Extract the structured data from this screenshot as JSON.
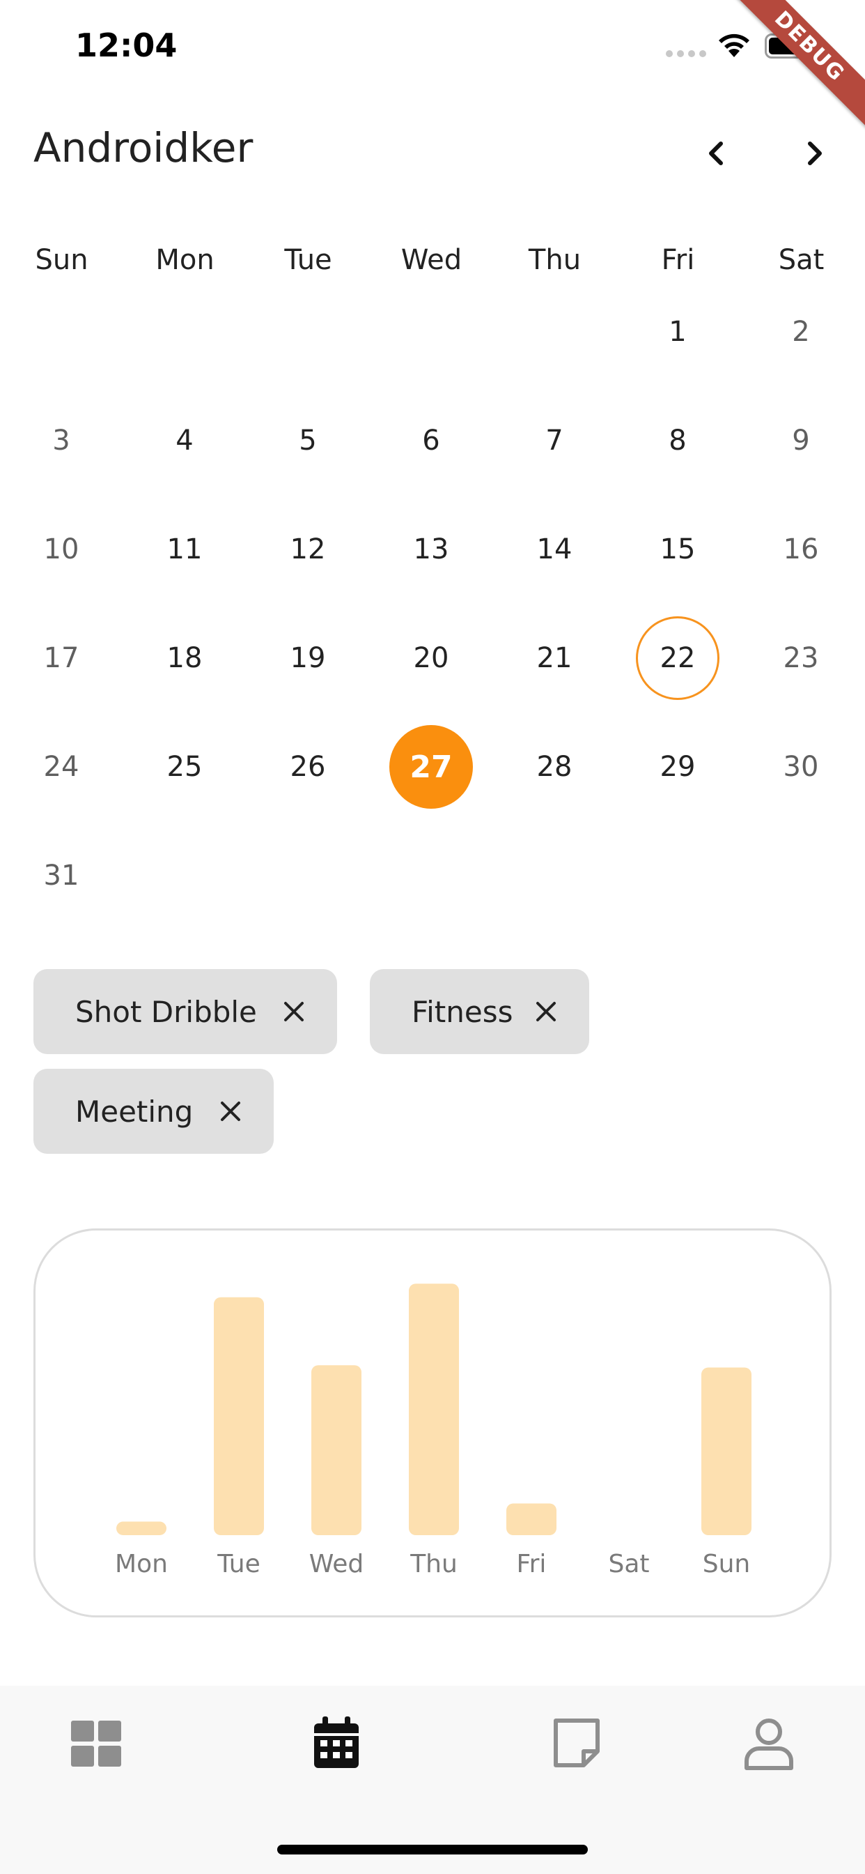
{
  "status_bar": {
    "time": "12:04",
    "debug_label": "DEBUG"
  },
  "header": {
    "title": "Androidker",
    "prev_icon": "chevron-left-icon",
    "next_icon": "chevron-right-icon"
  },
  "calendar": {
    "weekdays": [
      "Sun",
      "Mon",
      "Tue",
      "Wed",
      "Thu",
      "Fri",
      "Sat"
    ],
    "first_weekday_index": 5,
    "days_in_month": 31,
    "today": 22,
    "selected": 27
  },
  "tags": [
    {
      "label": "Shot Dribble",
      "remove_icon": "close-icon"
    },
    {
      "label": "Fitness",
      "remove_icon": "close-icon"
    },
    {
      "label": "Meeting",
      "remove_icon": "close-icon"
    }
  ],
  "chart_data": {
    "type": "bar",
    "categories": [
      "Mon",
      "Tue",
      "Wed",
      "Thu",
      "Fri",
      "Sat",
      "Sun"
    ],
    "values": [
      0.6,
      10.5,
      7.5,
      11.1,
      1.4,
      0,
      7.4
    ],
    "ylim": [
      0,
      12
    ],
    "bar_color": "#fde0b0",
    "label_color": "#7a7a7a",
    "grid": false
  },
  "bottom_nav": [
    {
      "icon": "dashboard-icon",
      "active": false
    },
    {
      "icon": "calendar-icon",
      "active": true
    },
    {
      "icon": "note-icon",
      "active": false
    },
    {
      "icon": "profile-icon",
      "active": false
    }
  ],
  "colors": {
    "accent": "#fa8f0e",
    "chip_bg": "#e0e0e0",
    "nav_bg": "#f8f8f8"
  }
}
